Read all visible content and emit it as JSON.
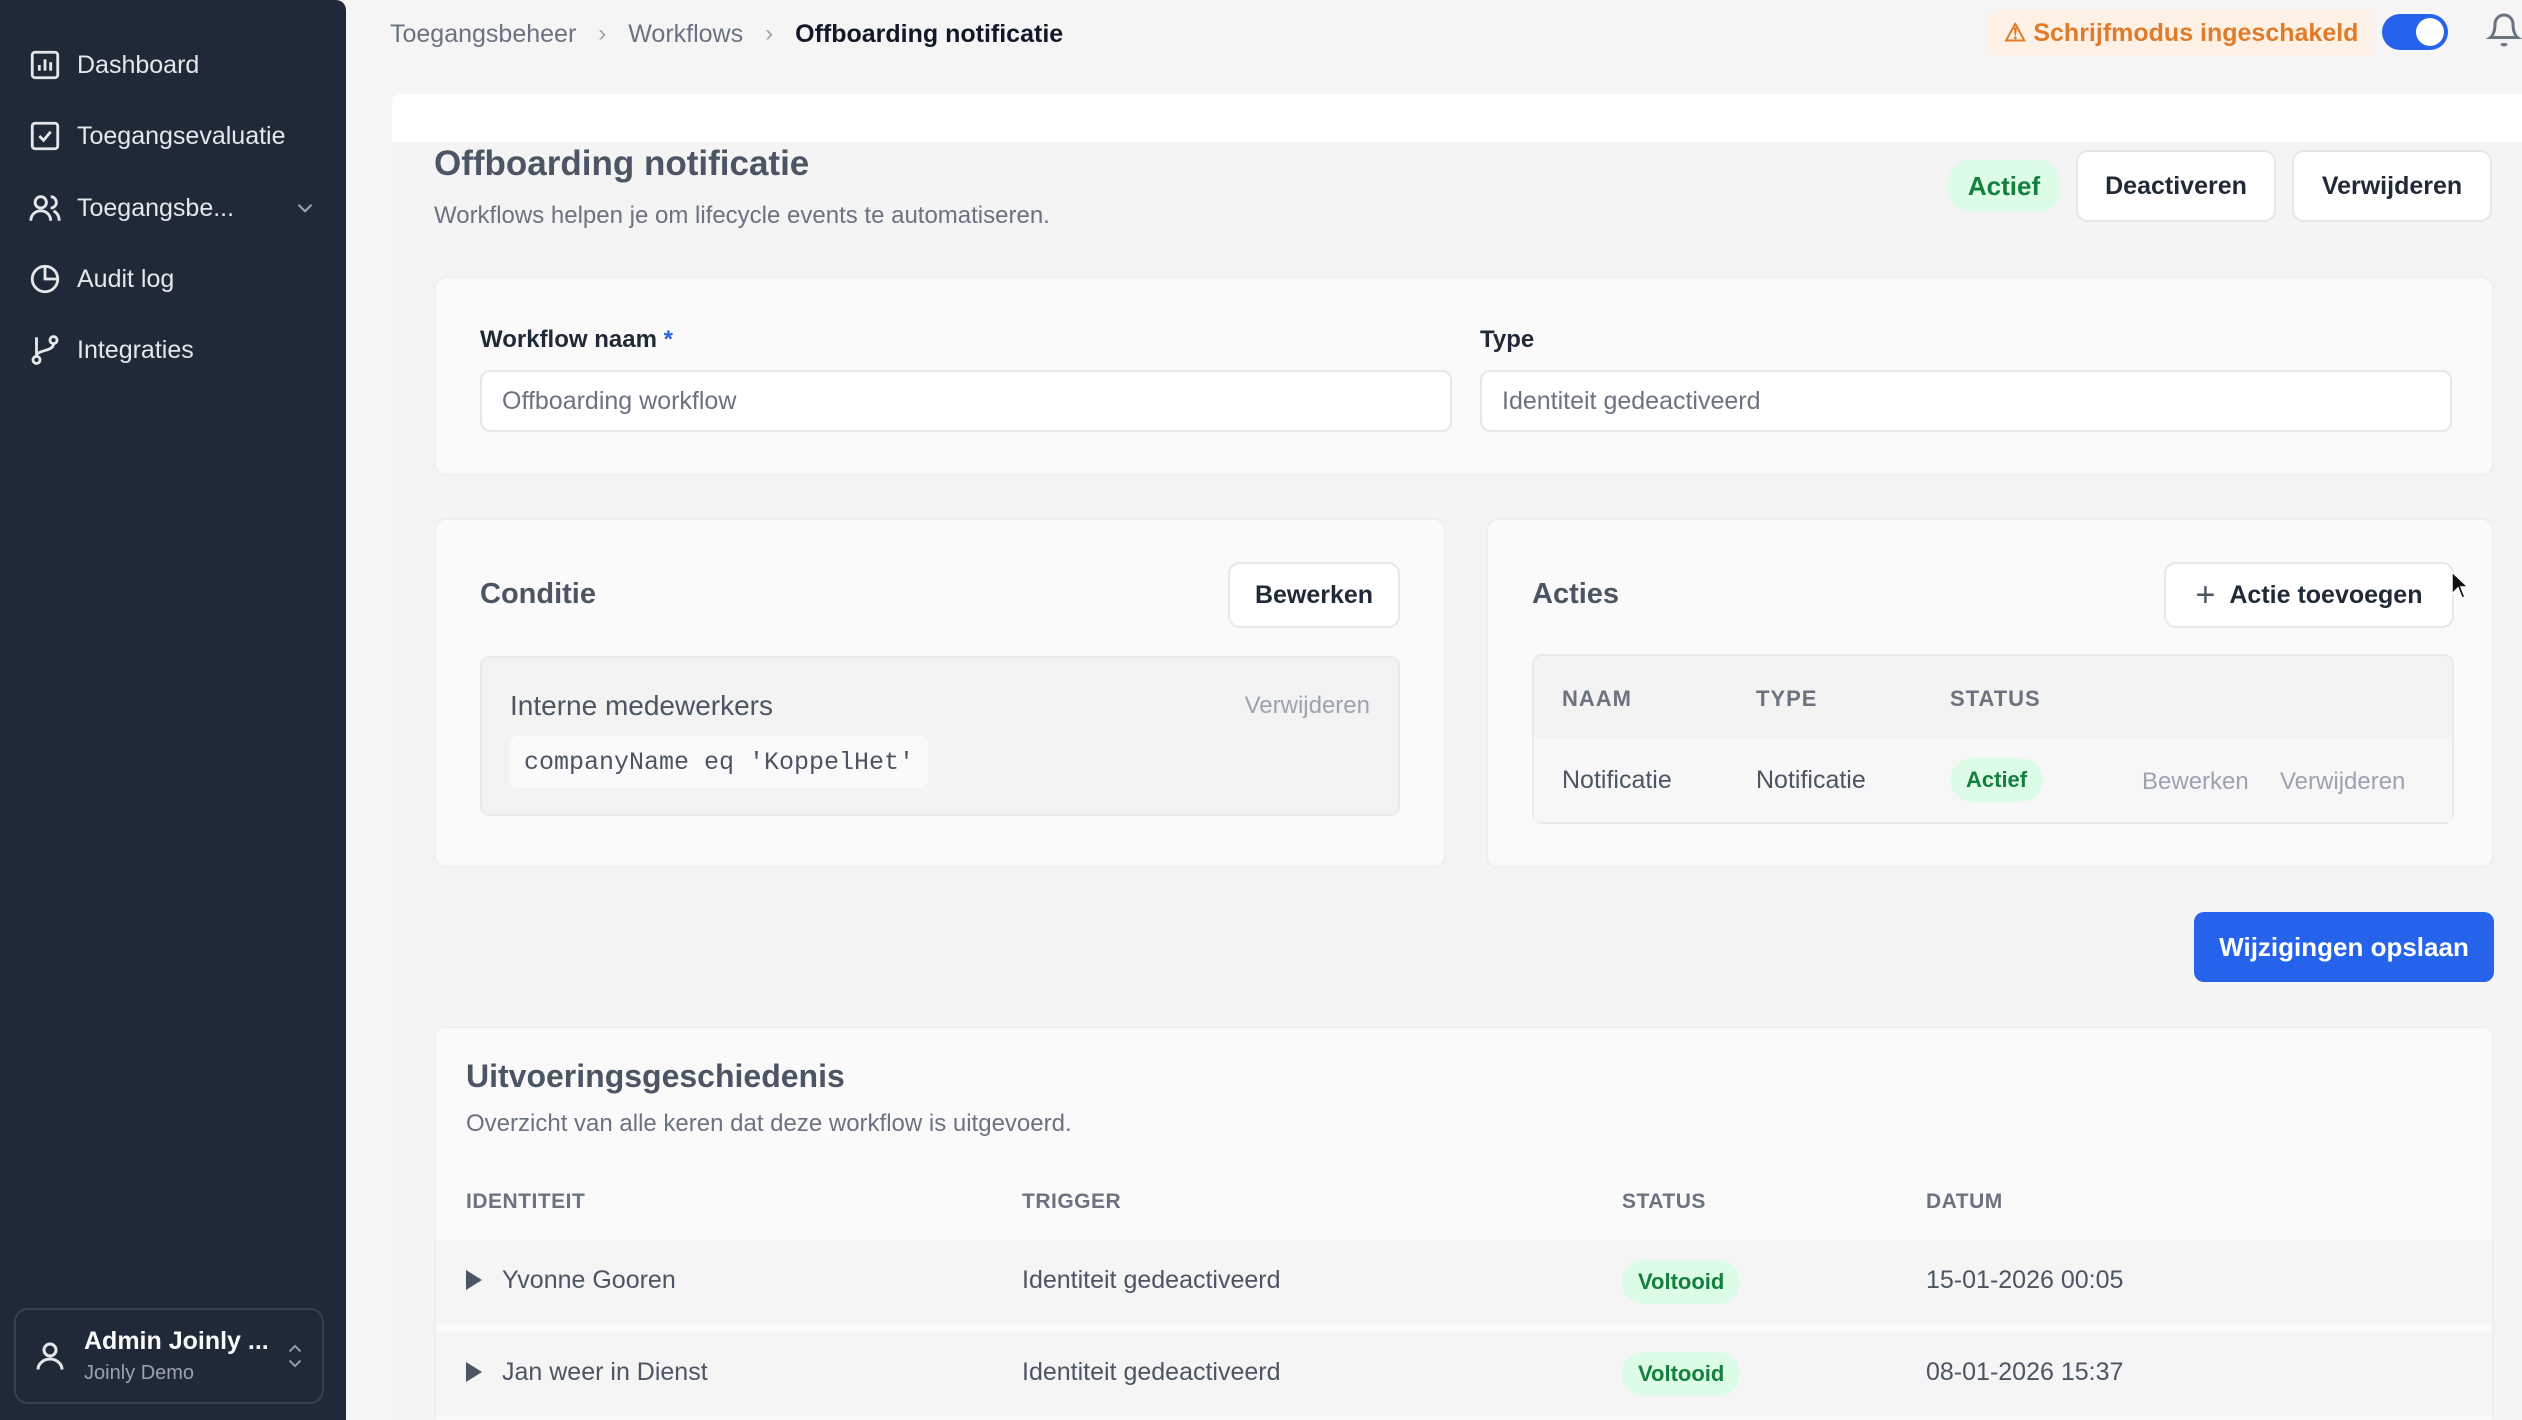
{
  "sidebar": {
    "items": [
      {
        "label": "Dashboard"
      },
      {
        "label": "Toegangsevaluatie"
      },
      {
        "label": "Toegangsbe..."
      },
      {
        "label": "Audit log"
      },
      {
        "label": "Integraties"
      }
    ],
    "user": {
      "name": "Admin Joinly ...",
      "org": "Joinly Demo"
    }
  },
  "header": {
    "breadcrumb": [
      "Toegangsbeheer",
      "Workflows",
      "Offboarding notificatie"
    ],
    "write_mode": "⚠ Schrijfmodus ingeschakeld"
  },
  "page": {
    "title": "Offboarding notificatie",
    "subtitle": "Workflows helpen je om lifecycle events te automatiseren.",
    "status": "Actief",
    "deactivate_label": "Deactiveren",
    "delete_label": "Verwijderen"
  },
  "form": {
    "name_label": "Workflow naam",
    "name_required": "*",
    "name_value": "Offboarding workflow",
    "type_label": "Type",
    "type_value": "Identiteit gedeactiveerd"
  },
  "condition": {
    "title": "Conditie",
    "edit_label": "Bewerken",
    "name": "Interne medewerkers",
    "delete_label": "Verwijderen",
    "expression": "companyName eq 'KoppelHet'"
  },
  "actions": {
    "title": "Acties",
    "add_label": "Actie toevoegen",
    "columns": [
      "NAAM",
      "TYPE",
      "STATUS"
    ],
    "rows": [
      {
        "name": "Notificatie",
        "type": "Notificatie",
        "status": "Actief",
        "edit": "Bewerken",
        "delete": "Verwijderen"
      }
    ]
  },
  "save_label": "Wijzigingen opslaan",
  "history": {
    "title": "Uitvoeringsgeschiedenis",
    "subtitle": "Overzicht van alle keren dat deze workflow is uitgevoerd.",
    "columns": [
      "IDENTITEIT",
      "TRIGGER",
      "STATUS",
      "DATUM"
    ],
    "rows": [
      {
        "identity": "Yvonne Gooren",
        "trigger": "Identiteit gedeactiveerd",
        "status": "Voltooid",
        "date": "15-01-2026 00:05"
      },
      {
        "identity": "Jan weer in Dienst",
        "trigger": "Identiteit gedeactiveerd",
        "status": "Voltooid",
        "date": "08-01-2026 15:37"
      }
    ]
  },
  "colors": {
    "sidebar": "#1f2937",
    "primary": "#2563eb",
    "success_bg": "#dcfce7",
    "success_text": "#15803d",
    "warning": "#e07b2a"
  }
}
